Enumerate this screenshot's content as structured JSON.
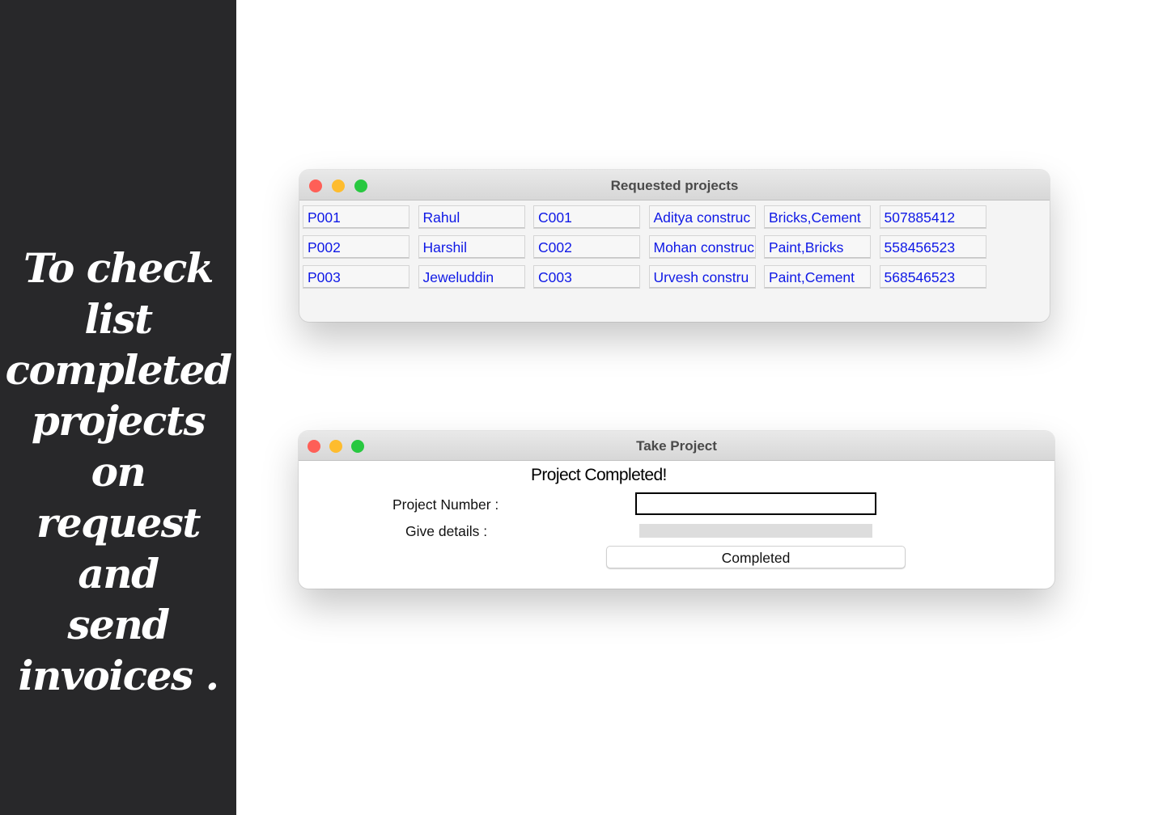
{
  "caption": {
    "lines": [
      "To check",
      "list",
      "completed",
      "projects on",
      "request and",
      "send",
      "invoices ."
    ]
  },
  "colors": {
    "sidebar_bg": "#28282a",
    "cell_text": "#0f19e6",
    "close": "#fe5f57",
    "minimize": "#febc2e",
    "maximize": "#28c840"
  },
  "requested_window": {
    "title": "Requested projects",
    "rows": [
      [
        "P001",
        "Rahul",
        "C001",
        "Aditya construc",
        "Bricks,Cement",
        "507885412"
      ],
      [
        "P002",
        "Harshil",
        "C002",
        "Mohan construc",
        "Paint,Bricks",
        "558456523"
      ],
      [
        "P003",
        "Jeweluddin",
        "C003",
        "Urvesh constru",
        "Paint,Cement",
        "568546523"
      ]
    ]
  },
  "take_window": {
    "title": "Take Project",
    "status": "Project Completed!",
    "project_number_label": "Project Number :",
    "project_number_value": "",
    "give_details_label": "Give details :",
    "give_details_value": "",
    "completed_button": "Completed"
  }
}
